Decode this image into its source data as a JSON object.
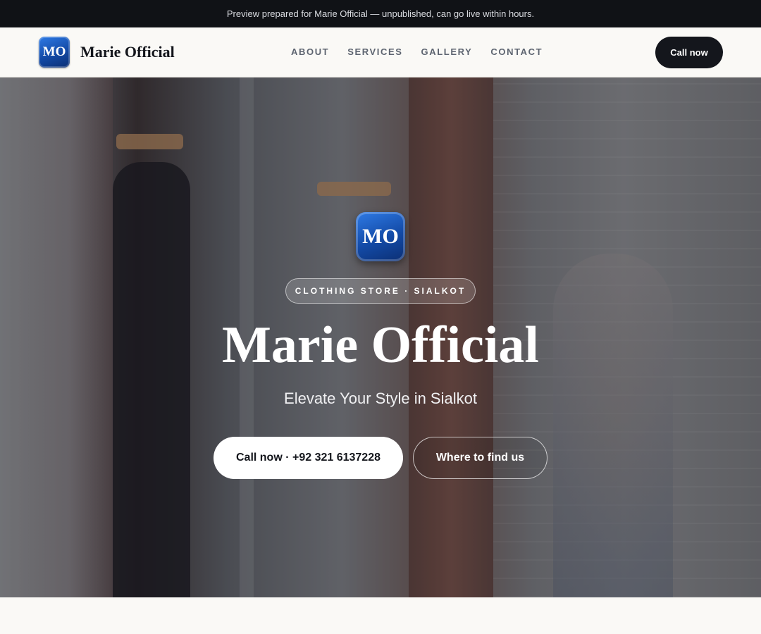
{
  "announcement": {
    "text": "Preview prepared for Marie Official — unpublished, can go live within hours."
  },
  "header": {
    "logo_text": "MO",
    "brand_name": "Marie Official",
    "nav": [
      "ABOUT",
      "SERVICES",
      "GALLERY",
      "CONTACT"
    ],
    "cta_label": "Call now"
  },
  "hero": {
    "logo_text": "MO",
    "tagline": "CLOTHING STORE · SIALKOT",
    "title": "Marie Official",
    "subtitle": "Elevate Your Style in Sialkot",
    "primary_cta": "Call now · +92 321 6137228",
    "secondary_cta": "Where to find us"
  },
  "colors": {
    "accent_dark": "#14161c",
    "logo_blue": "#134aa6",
    "page_bg": "#faf9f6"
  }
}
